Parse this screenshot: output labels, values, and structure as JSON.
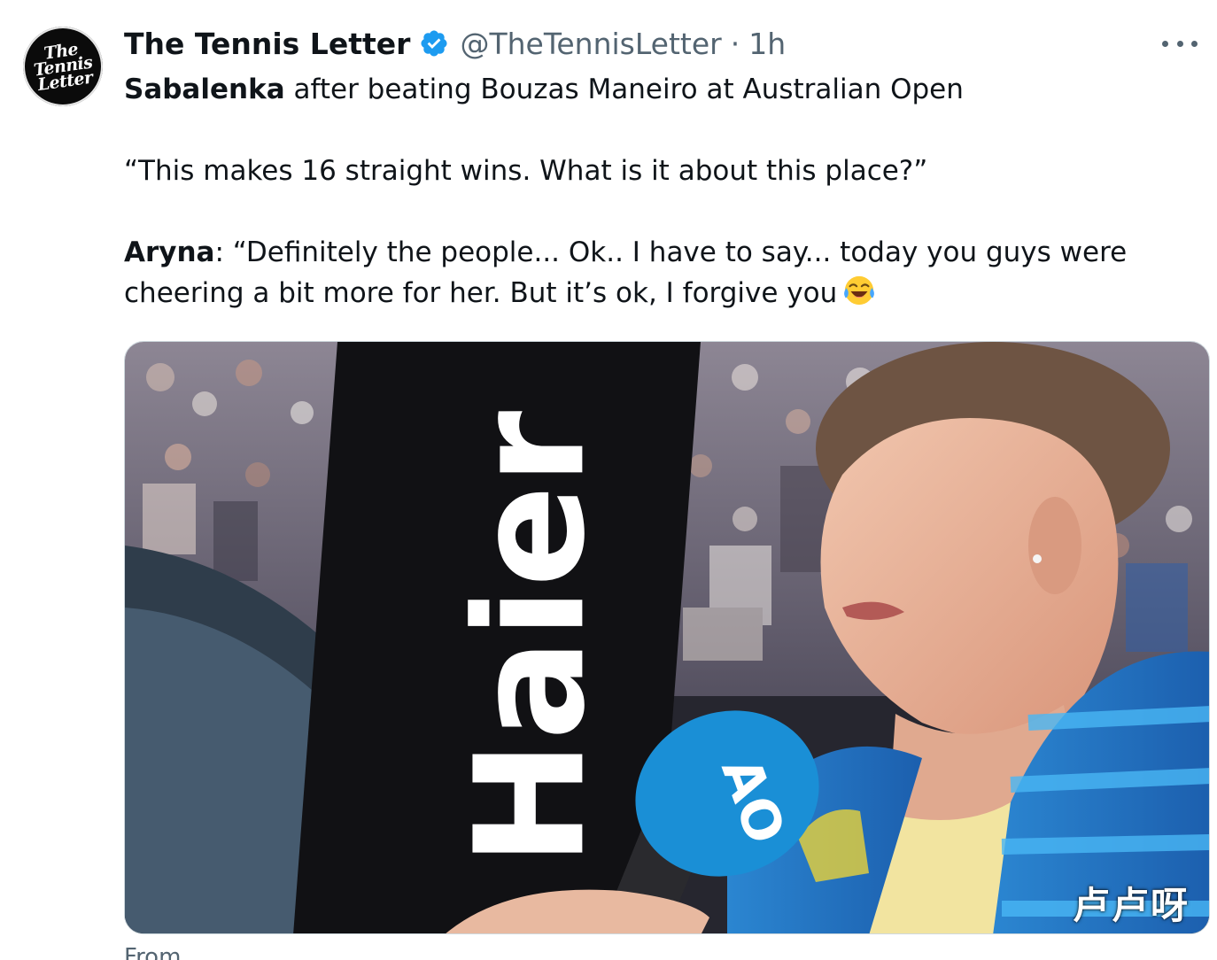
{
  "account": {
    "avatar_text": "The\nTennis\nLetter",
    "display_name": "The Tennis Letter",
    "handle": "@TheTennisLetter",
    "separator": "·",
    "time": "1h"
  },
  "tweet": {
    "line1_bold": "Sabalenka",
    "line1_rest": " after beating Bouzas Maneiro at Australian Open",
    "quote": "“This makes 16 straight wins. What is it about this place?”",
    "speaker": "Aryna",
    "answer": ": “Definitely the people... Ok.. I have to say... today you guys were cheering a bit more for her. But it’s ok, I forgive you",
    "emoji": "face-with-tears-of-joy"
  },
  "media": {
    "board_text": "Haier",
    "mic_logo": "AO",
    "watermark": "卢卢呀"
  },
  "footer": {
    "from_label": "From"
  },
  "colors": {
    "verified": "#1d9bf0",
    "secondary_text": "#536471",
    "mic_blue": "#1a8fd6"
  }
}
